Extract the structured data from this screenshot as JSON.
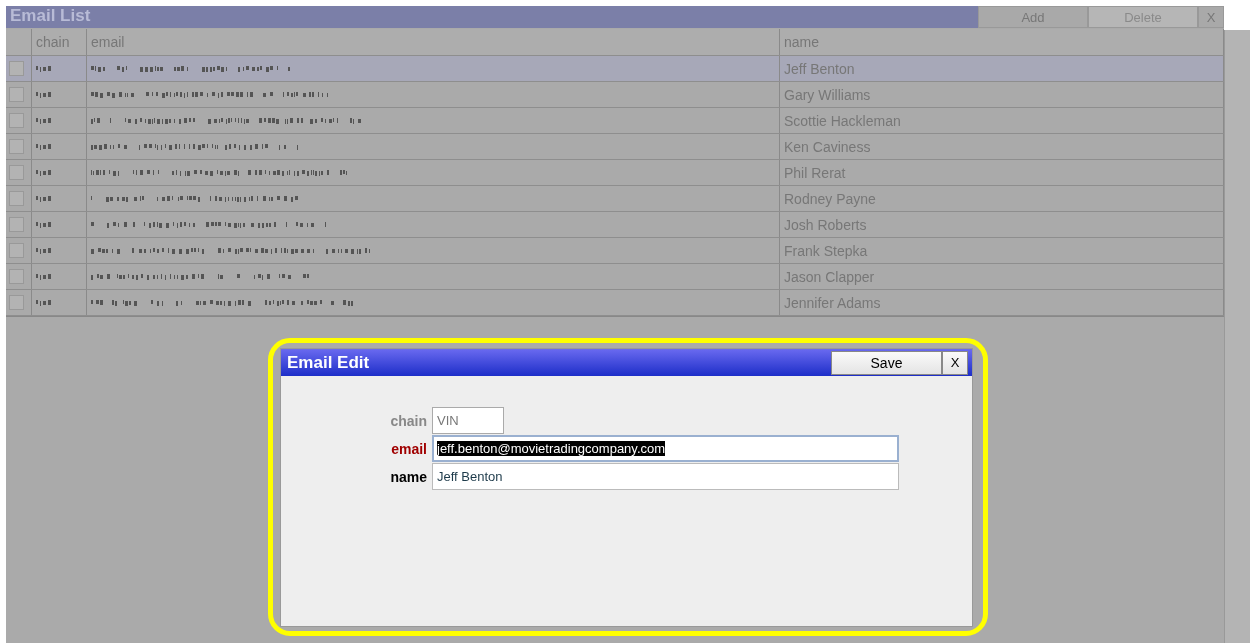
{
  "list_window": {
    "title": "Email List",
    "buttons": [
      {
        "label": "Add",
        "disabled": false
      },
      {
        "label": "Delete",
        "disabled": true
      }
    ],
    "close": "X"
  },
  "table": {
    "columns": [
      {
        "label": "chain"
      },
      {
        "label": "email"
      },
      {
        "label": "name"
      }
    ],
    "rows": [
      {
        "name": "Jeff Benton",
        "selected": true,
        "checked": false
      },
      {
        "name": "Gary Williams",
        "selected": false,
        "checked": false
      },
      {
        "name": "Scottie Hackleman",
        "selected": false,
        "checked": false
      },
      {
        "name": "Ken Caviness",
        "selected": false,
        "checked": false
      },
      {
        "name": "Phil Rerat",
        "selected": false,
        "checked": false
      },
      {
        "name": "Rodney Payne",
        "selected": false,
        "checked": false
      },
      {
        "name": "Josh Roberts",
        "selected": false,
        "checked": false
      },
      {
        "name": "Frank Stepka",
        "selected": false,
        "checked": false
      },
      {
        "name": "Jason Clapper",
        "selected": false,
        "checked": false
      },
      {
        "name": "Jennifer Adams",
        "selected": false,
        "checked": false
      }
    ]
  },
  "dialog": {
    "title": "Email Edit",
    "save": "Save",
    "close": "X",
    "fields": [
      {
        "label": "chain",
        "kind": "readonly",
        "value": "VIN"
      },
      {
        "label": "email",
        "kind": "required",
        "value": "jeff.benton@movietradingcompany.com",
        "selected": true
      },
      {
        "label": "name",
        "kind": "normal",
        "value": "Jeff Benton",
        "selected": false
      }
    ]
  }
}
